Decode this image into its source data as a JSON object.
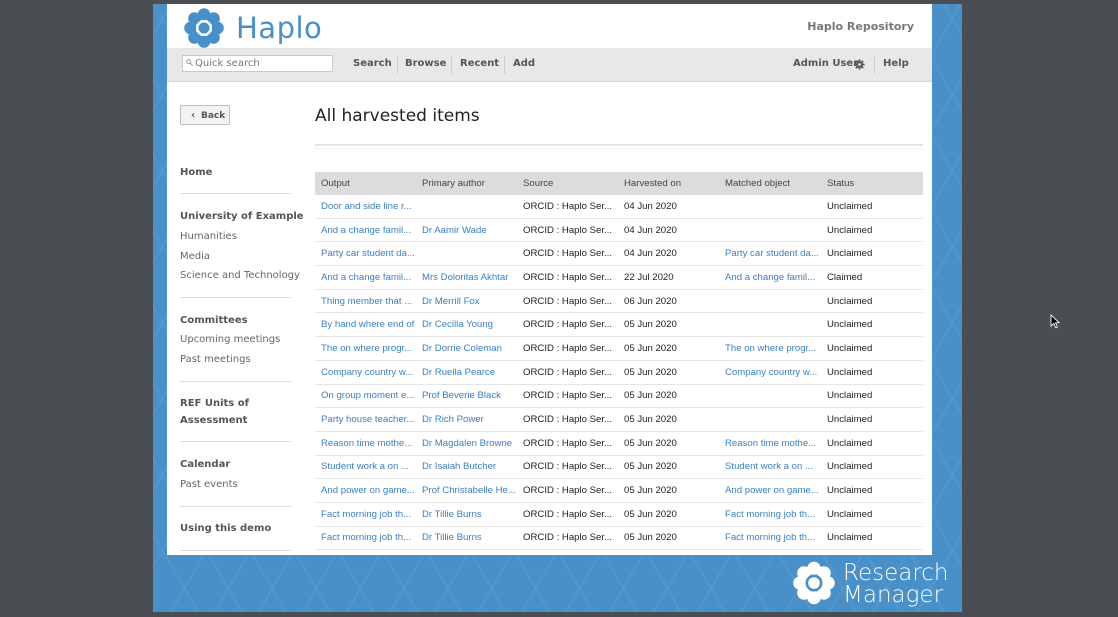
{
  "app": {
    "logo_text": "Haplo",
    "repository_name": "Haplo Repository"
  },
  "navbar": {
    "search_placeholder": "Quick search",
    "links": [
      "Search",
      "Browse",
      "Recent",
      "Add"
    ],
    "user": "Admin User",
    "help": "Help"
  },
  "back_button": {
    "label": "Back"
  },
  "sidebar": {
    "home": "Home",
    "university": {
      "heading": "University of Example",
      "items": [
        "Humanities",
        "Media",
        "Science and Technology"
      ]
    },
    "committees": {
      "heading": "Committees",
      "items": [
        "Upcoming meetings",
        "Past meetings"
      ]
    },
    "ref": {
      "heading_line1": "REF Units of",
      "heading_line2": "Assessment"
    },
    "calendar": {
      "heading": "Calendar",
      "items": [
        "Past events"
      ]
    },
    "using_demo": "Using this demo"
  },
  "main": {
    "title": "All harvested items",
    "columns": [
      "Output",
      "Primary author",
      "Source",
      "Harvested on",
      "Matched object",
      "Status"
    ],
    "rows": [
      [
        "Door and side line r...",
        "",
        "ORCID : Haplo Ser...",
        "04 Jun 2020",
        "",
        "Unclaimed"
      ],
      [
        "And a change famil...",
        "Dr Aamir Wade",
        "ORCID : Haplo Ser...",
        "04 Jun 2020",
        "",
        "Unclaimed"
      ],
      [
        "Party car student da...",
        "",
        "ORCID : Haplo Ser...",
        "04 Jun 2020",
        "Party car student da...",
        "Unclaimed"
      ],
      [
        "And a change famil...",
        "Mrs Doloritas Akhtar",
        "ORCID : Haplo Ser...",
        "22 Jul 2020",
        "And a change famil...",
        "Claimed"
      ],
      [
        "Thing member that ...",
        "Dr Merrill Fox",
        "ORCID : Haplo Ser...",
        "06 Jun 2020",
        "",
        "Unclaimed"
      ],
      [
        "By hand where end of",
        "Dr Cecilla Young",
        "ORCID : Haplo Ser...",
        "05 Jun 2020",
        "",
        "Unclaimed"
      ],
      [
        "The on where progr...",
        "Dr Dorrie Coleman",
        "ORCID : Haplo Ser...",
        "05 Jun 2020",
        "The on where progr...",
        "Unclaimed"
      ],
      [
        "Company country w...",
        "Dr Ruella Pearce",
        "ORCID : Haplo Ser...",
        "05 Jun 2020",
        "Company country w...",
        "Unclaimed"
      ],
      [
        "On group moment e...",
        "Prof Beverie Black",
        "ORCID : Haplo Ser...",
        "05 Jun 2020",
        "",
        "Unclaimed"
      ],
      [
        "Party house teacher...",
        "Dr Rich Power",
        "ORCID : Haplo Ser...",
        "05 Jun 2020",
        "",
        "Unclaimed"
      ],
      [
        "Reason time mothe...",
        "Dr Magdalen Browne",
        "ORCID : Haplo Ser...",
        "05 Jun 2020",
        "Reason time mothe...",
        "Unclaimed"
      ],
      [
        "Student work a on ...",
        "Dr Isaiah Butcher",
        "ORCID : Haplo Ser...",
        "05 Jun 2020",
        "Student work a on ...",
        "Unclaimed"
      ],
      [
        "And power on game...",
        "Prof Christabelle He...",
        "ORCID : Haplo Ser...",
        "05 Jun 2020",
        "And power on game...",
        "Unclaimed"
      ],
      [
        "Fact morning job th...",
        "Dr Tillie Burns",
        "ORCID : Haplo Ser...",
        "05 Jun 2020",
        "Fact morning job th...",
        "Unclaimed"
      ],
      [
        "Fact morning job th...",
        "Dr Tillie Burns",
        "ORCID : Haplo Ser...",
        "05 Jun 2020",
        "Fact morning job th...",
        "Unclaimed"
      ]
    ]
  },
  "footer": {
    "brand_line1": "Research",
    "brand_line2": "Manager"
  },
  "colors": {
    "brand_blue": "#4a90c8",
    "link": "#3a7fc1",
    "backdrop": "#4a4d51",
    "header_gray": "#dcdcdc"
  },
  "icons": [
    "flower-logo-icon",
    "search-icon",
    "gear-icon",
    "chevron-left-icon",
    "mouse-cursor-icon"
  ]
}
